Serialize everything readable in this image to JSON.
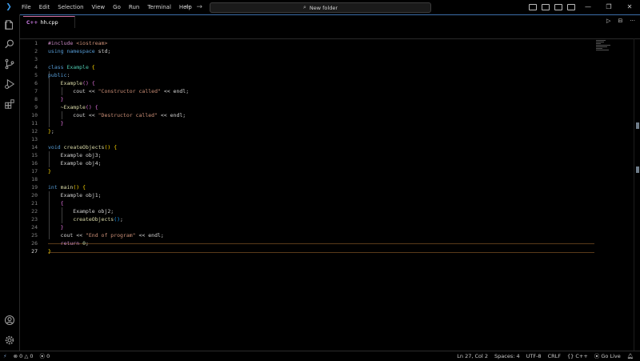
{
  "menu": [
    "File",
    "Edit",
    "Selection",
    "View",
    "Go",
    "Run",
    "Terminal",
    "Help"
  ],
  "nav": {
    "back": "←",
    "forward": "→"
  },
  "command_center": {
    "label": "New folder"
  },
  "window_controls": {
    "minimize": "—",
    "restore": "❐",
    "close": "✕"
  },
  "tab": {
    "icon": "C++",
    "label": "hh.cpp"
  },
  "run_actions": {
    "run": "▷",
    "split": "⊟",
    "more": "···"
  },
  "activity": [
    "explorer-icon",
    "search-icon",
    "source-control-icon",
    "run-debug-icon",
    "extensions-icon",
    "account-icon",
    "settings-gear-icon"
  ],
  "editor": {
    "current_line": 27,
    "lines": [
      [
        [
          "pp",
          "#include "
        ],
        [
          "str",
          "<iostream>"
        ]
      ],
      [
        [
          "kw",
          "using namespace "
        ],
        [
          "plain",
          "std;"
        ]
      ],
      [],
      [
        [
          "kw",
          "class "
        ],
        [
          "ty",
          "Example "
        ],
        [
          "br1",
          "{"
        ]
      ],
      [
        [
          "kw",
          "public"
        ],
        [
          "plain",
          ":"
        ]
      ],
      [
        [
          "plain",
          "    "
        ],
        [
          "fn",
          "Example"
        ],
        [
          "br2",
          "()"
        ],
        [
          "plain",
          " "
        ],
        [
          "br2",
          "{"
        ]
      ],
      [
        [
          "plain",
          "        cout << "
        ],
        [
          "str",
          "\"Constructor called\""
        ],
        [
          "plain",
          " << endl;"
        ]
      ],
      [
        [
          "plain",
          "    "
        ],
        [
          "br2",
          "}"
        ]
      ],
      [
        [
          "plain",
          "    "
        ],
        [
          "fn",
          "~Example"
        ],
        [
          "br2",
          "()"
        ],
        [
          "plain",
          " "
        ],
        [
          "br2",
          "{"
        ]
      ],
      [
        [
          "plain",
          "        cout << "
        ],
        [
          "str",
          "\"Destructor called\""
        ],
        [
          "plain",
          " << endl;"
        ]
      ],
      [
        [
          "plain",
          "    "
        ],
        [
          "br2",
          "}"
        ]
      ],
      [
        [
          "br1",
          "}"
        ],
        [
          "plain",
          ";"
        ]
      ],
      [],
      [
        [
          "kw",
          "void "
        ],
        [
          "fn",
          "createObjects"
        ],
        [
          "br1",
          "()"
        ],
        [
          "plain",
          " "
        ],
        [
          "br1",
          "{"
        ]
      ],
      [
        [
          "plain",
          "    Example obj3;"
        ]
      ],
      [
        [
          "plain",
          "    Example obj4;"
        ]
      ],
      [
        [
          "br1",
          "}"
        ]
      ],
      [],
      [
        [
          "kw",
          "int "
        ],
        [
          "fn",
          "main"
        ],
        [
          "br1",
          "()"
        ],
        [
          "plain",
          " "
        ],
        [
          "br1",
          "{"
        ]
      ],
      [
        [
          "plain",
          "    Example obj1;"
        ]
      ],
      [
        [
          "plain",
          "    "
        ],
        [
          "br2",
          "{"
        ]
      ],
      [
        [
          "plain",
          "        Example obj2;"
        ]
      ],
      [
        [
          "plain",
          "        "
        ],
        [
          "fn",
          "createObjects"
        ],
        [
          "br3",
          "()"
        ],
        [
          "plain",
          ";"
        ]
      ],
      [
        [
          "plain",
          "    "
        ],
        [
          "br2",
          "}"
        ]
      ],
      [
        [
          "plain",
          "    cout << "
        ],
        [
          "str",
          "\"End of program\""
        ],
        [
          "plain",
          " << endl;"
        ]
      ],
      [
        [
          "plain",
          "    "
        ],
        [
          "pp",
          "return "
        ],
        [
          "num",
          "0"
        ],
        [
          "plain",
          ";"
        ]
      ],
      [
        [
          "br1",
          "}"
        ]
      ]
    ]
  },
  "status": {
    "remote": "⚡",
    "errors": "0",
    "warnings": "0",
    "ports": "0",
    "position": "Ln 27, Col 2",
    "spaces": "Spaces: 4",
    "encoding": "UTF-8",
    "eol": "CRLF",
    "language": "C++",
    "golive": "Go Live"
  }
}
